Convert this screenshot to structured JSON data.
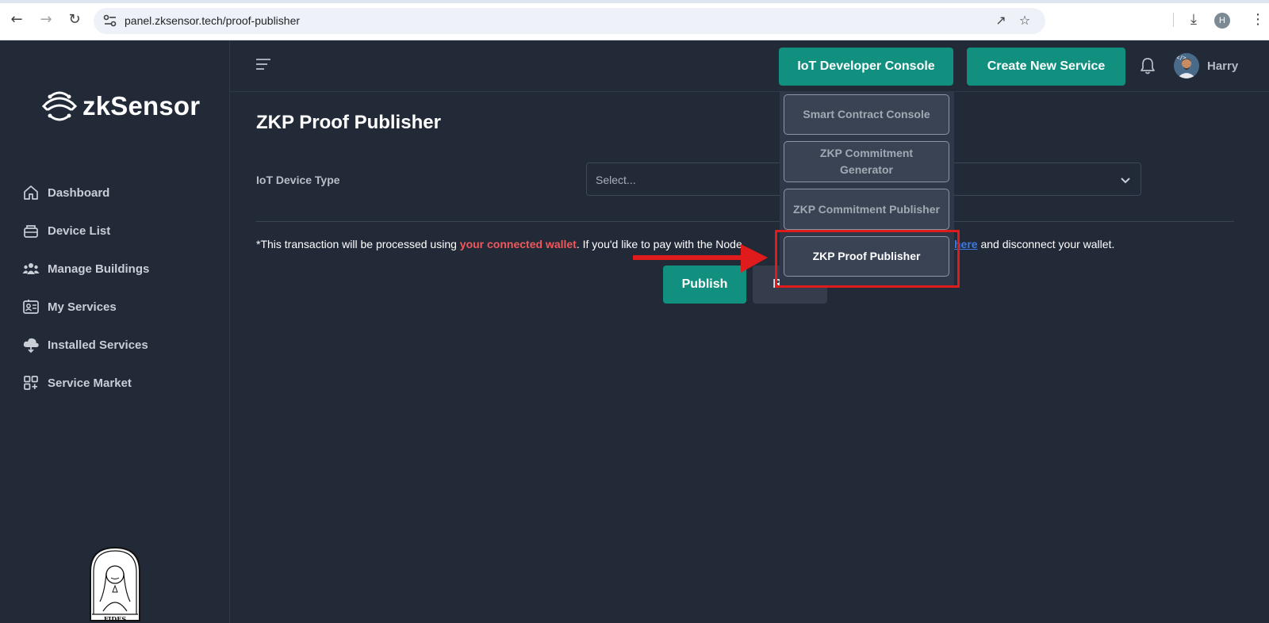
{
  "browser": {
    "url": "panel.zksensor.tech/proof-publisher",
    "profile_initial": "H"
  },
  "brand": {
    "name": "zkSensor"
  },
  "sidebar": {
    "items": [
      {
        "label": "Dashboard",
        "icon": "home-icon"
      },
      {
        "label": "Device List",
        "icon": "device-icon"
      },
      {
        "label": "Manage Buildings",
        "icon": "people-icon"
      },
      {
        "label": "My Services",
        "icon": "id-card-icon"
      },
      {
        "label": "Installed Services",
        "icon": "cloud-download-icon"
      },
      {
        "label": "Service Market",
        "icon": "grid-plus-icon"
      }
    ],
    "footer_logo_text": "FIDES"
  },
  "header": {
    "iot_console_label": "IoT Developer Console",
    "create_service_label": "Create New Service",
    "user_name": "Harry"
  },
  "dropdown": {
    "items": [
      {
        "label": "Smart Contract Console"
      },
      {
        "label": "ZKP Commitment Generator"
      },
      {
        "label": "ZKP Commitment Publisher"
      },
      {
        "label": "ZKP Proof Publisher"
      }
    ]
  },
  "main": {
    "title": "ZKP Proof Publisher",
    "device_type_label": "IoT Device Type",
    "device_type_placeholder": "Select...",
    "note_prefix": "*This transaction will be processed using ",
    "note_wallet": "your connected wallet",
    "note_middle": ". If you'd like to pay with the Node",
    "note_link": "here",
    "note_suffix": " and disconnect your wallet.",
    "publish_label": "Publish",
    "reset_label": "Reset"
  },
  "colors": {
    "accent": "#12907f",
    "background": "#222a38",
    "warning": "#f0585b",
    "annotation": "#e01b1b"
  }
}
